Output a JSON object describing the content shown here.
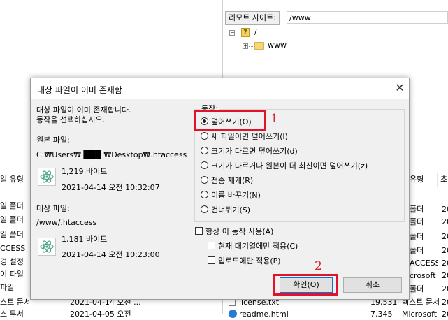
{
  "remote": {
    "label": "리모트 사이트:",
    "path": "/www",
    "tree": [
      {
        "name": "/",
        "icon": "question-mark-icon"
      },
      {
        "name": "www",
        "icon": "folder-icon"
      }
    ]
  },
  "left_list": {
    "header": "일 유형",
    "rows": [
      "일 폴더",
      "일 폴더",
      "일 폴더",
      "CCESS",
      "경 설정",
      "이 파일",
      "파일",
      "스트 문서",
      "스 무서"
    ]
  },
  "left_bottom_cells": {
    "date_row1": "2021-04-14 오전 ...",
    "date_row2": "2021-04-05 오전"
  },
  "right_list": {
    "header": "유형",
    "header_cut": "초",
    "types": [
      "폴더",
      "폴더",
      "폴더",
      "폴더",
      "ACCESS",
      "crosoft ...",
      "폴더"
    ],
    "years": [
      "20",
      "20",
      "20",
      "20",
      "20",
      "20",
      "20",
      "20"
    ],
    "bottom_rows": [
      {
        "name": "license.txt",
        "size": "19,531",
        "type": "텍스트 문서",
        "year": "20"
      },
      {
        "name": "readme.html",
        "size": "7,345",
        "type": "Microsoft",
        "year": "20"
      }
    ]
  },
  "dialog": {
    "title": "대상 파일이 이미 존재함",
    "message_line1": "대상 파일이 이미 존재합니다.",
    "message_line2": "동작을 선택하십시오.",
    "source_label": "원본 파일:",
    "source_path": "C:₩Users₩ ███ ₩Desktop₩.htaccess",
    "source_size": "1,219 바이트",
    "source_date": "2021-04-14 오전 10:32:07",
    "target_label": "대상 파일:",
    "target_path": "/www/.htaccess",
    "target_size": "1,181 바이트",
    "target_date": "2021-04-14 오전 10:23:00",
    "action_label": "동작:",
    "options": [
      "덮어쓰기(O)",
      "새 파일이면 덮어쓰기(I)",
      "크기가 다르면 덮어쓰기(d)",
      "크기가 다르거나 원본이 더 최신이면 덮어쓰기(z)",
      "전송 재개(R)",
      "이름 바꾸기(N)",
      "건너뛰기(S)"
    ],
    "selected_option": 0,
    "always_label": "항상 이 동작 사용(A)",
    "queue_only_label": "현재 대기열에만 적용(C)",
    "upload_only_label": "업로드에만 적용(P)",
    "ok_label": "확인(O)",
    "cancel_label": "취소"
  },
  "annotations": {
    "mark1": "1",
    "mark2": "2",
    "color": "#e0132a"
  }
}
